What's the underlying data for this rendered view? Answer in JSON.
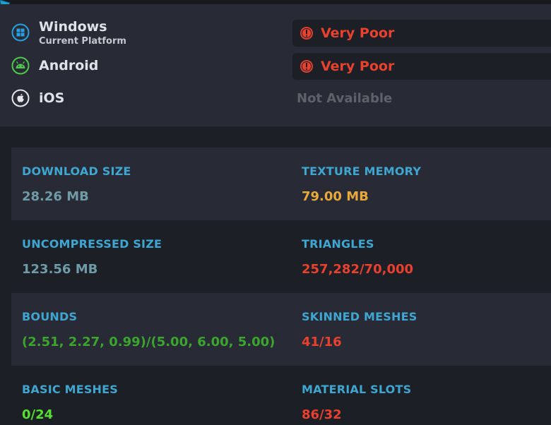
{
  "colors": {
    "label": "#3ea6d0",
    "neutral": "#6f9ba6",
    "warning": "#e9a93a",
    "error": "#e8412e",
    "ok_green": "#3ba52e",
    "bright_green": "#54e02d",
    "not_available": "#5d616a",
    "windows_blue": "#2a9fe0",
    "android_green": "#4cc94a"
  },
  "platforms": [
    {
      "name": "Windows",
      "subtitle": "Current Platform",
      "icon": "windows-icon",
      "rating": "Very Poor",
      "rating_icon": "error-icon"
    },
    {
      "name": "Android",
      "subtitle": "",
      "icon": "android-icon",
      "rating": "Very Poor",
      "rating_icon": "error-icon"
    },
    {
      "name": "iOS",
      "subtitle": "",
      "icon": "apple-icon",
      "status": "Not Available"
    }
  ],
  "stats": {
    "download_size": {
      "label": "DOWNLOAD SIZE",
      "value": "28.26 MB",
      "tone": "neutral"
    },
    "texture_memory": {
      "label": "TEXTURE MEMORY",
      "value": "79.00 MB",
      "tone": "warning"
    },
    "uncompressed_size": {
      "label": "UNCOMPRESSED SIZE",
      "value": "123.56 MB",
      "tone": "neutral"
    },
    "triangles": {
      "label": "TRIANGLES",
      "value": "257,282/70,000",
      "tone": "error"
    },
    "bounds": {
      "label": "BOUNDS",
      "value": "(2.51, 2.27, 0.99)/(5.00, 6.00, 5.00)",
      "tone": "ok_green"
    },
    "skinned_meshes": {
      "label": "SKINNED MESHES",
      "value": "41/16",
      "tone": "error"
    },
    "basic_meshes": {
      "label": "BASIC MESHES",
      "value": "0/24",
      "tone": "bright_green"
    },
    "material_slots": {
      "label": "MATERIAL SLOTS",
      "value": "86/32",
      "tone": "error"
    }
  }
}
